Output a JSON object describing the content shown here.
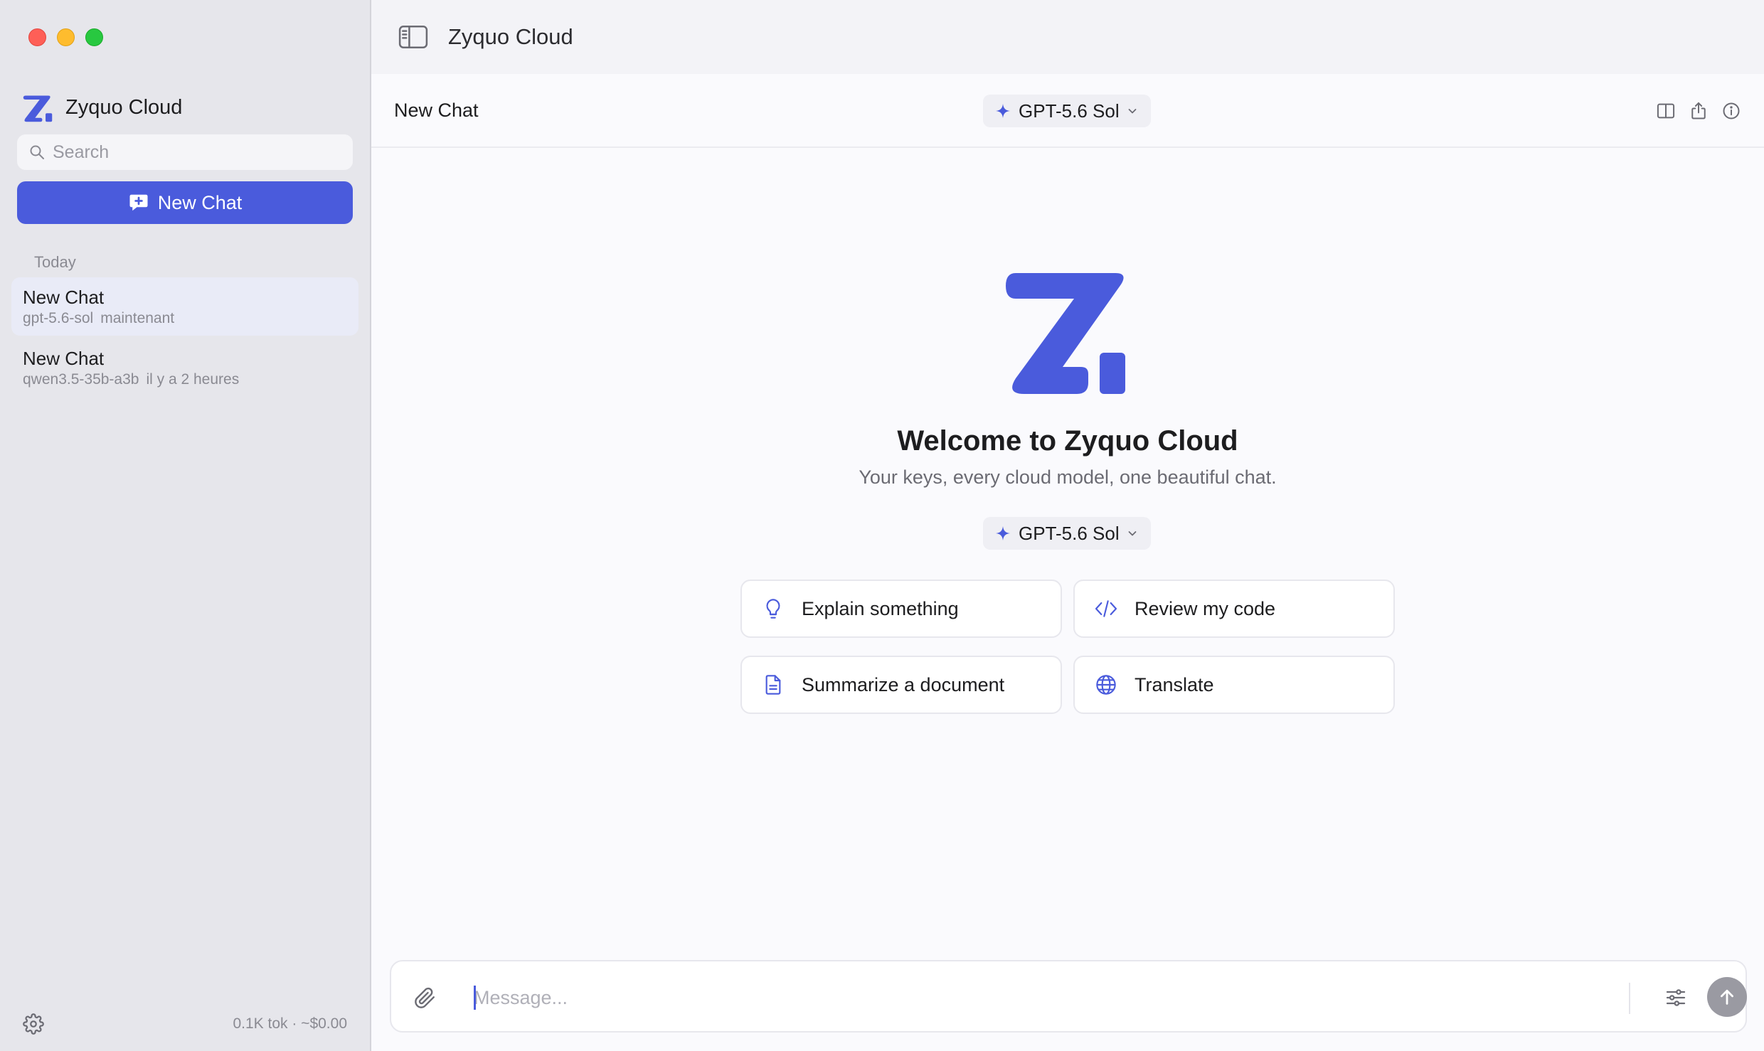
{
  "app": {
    "title": "Zyquo Cloud",
    "accent": "#4a5bdc"
  },
  "sidebar": {
    "brand": "Zyquo Cloud",
    "search_placeholder": "Search",
    "new_chat_label": "New Chat",
    "section_today": "Today",
    "chats": [
      {
        "title": "New Chat",
        "model": "gpt-5.6-sol",
        "time": "maintenant",
        "active": true
      },
      {
        "title": "New Chat",
        "model": "qwen3.5-35b-a3b",
        "time": "il y a 2 heures",
        "active": false
      }
    ],
    "usage": "0.1K tok · ~$0.00"
  },
  "header": {
    "chat_title": "New Chat",
    "model": "GPT-5.6 Sol"
  },
  "welcome": {
    "title": "Welcome to Zyquo Cloud",
    "subtitle": "Your keys, every cloud model, one beautiful chat.",
    "model": "GPT-5.6 Sol",
    "suggestions": [
      {
        "label": "Explain something",
        "icon": "lightbulb-icon"
      },
      {
        "label": "Review my code",
        "icon": "code-icon"
      },
      {
        "label": "Summarize a document",
        "icon": "document-icon"
      },
      {
        "label": "Translate",
        "icon": "globe-icon"
      }
    ]
  },
  "composer": {
    "placeholder": "Message..."
  }
}
